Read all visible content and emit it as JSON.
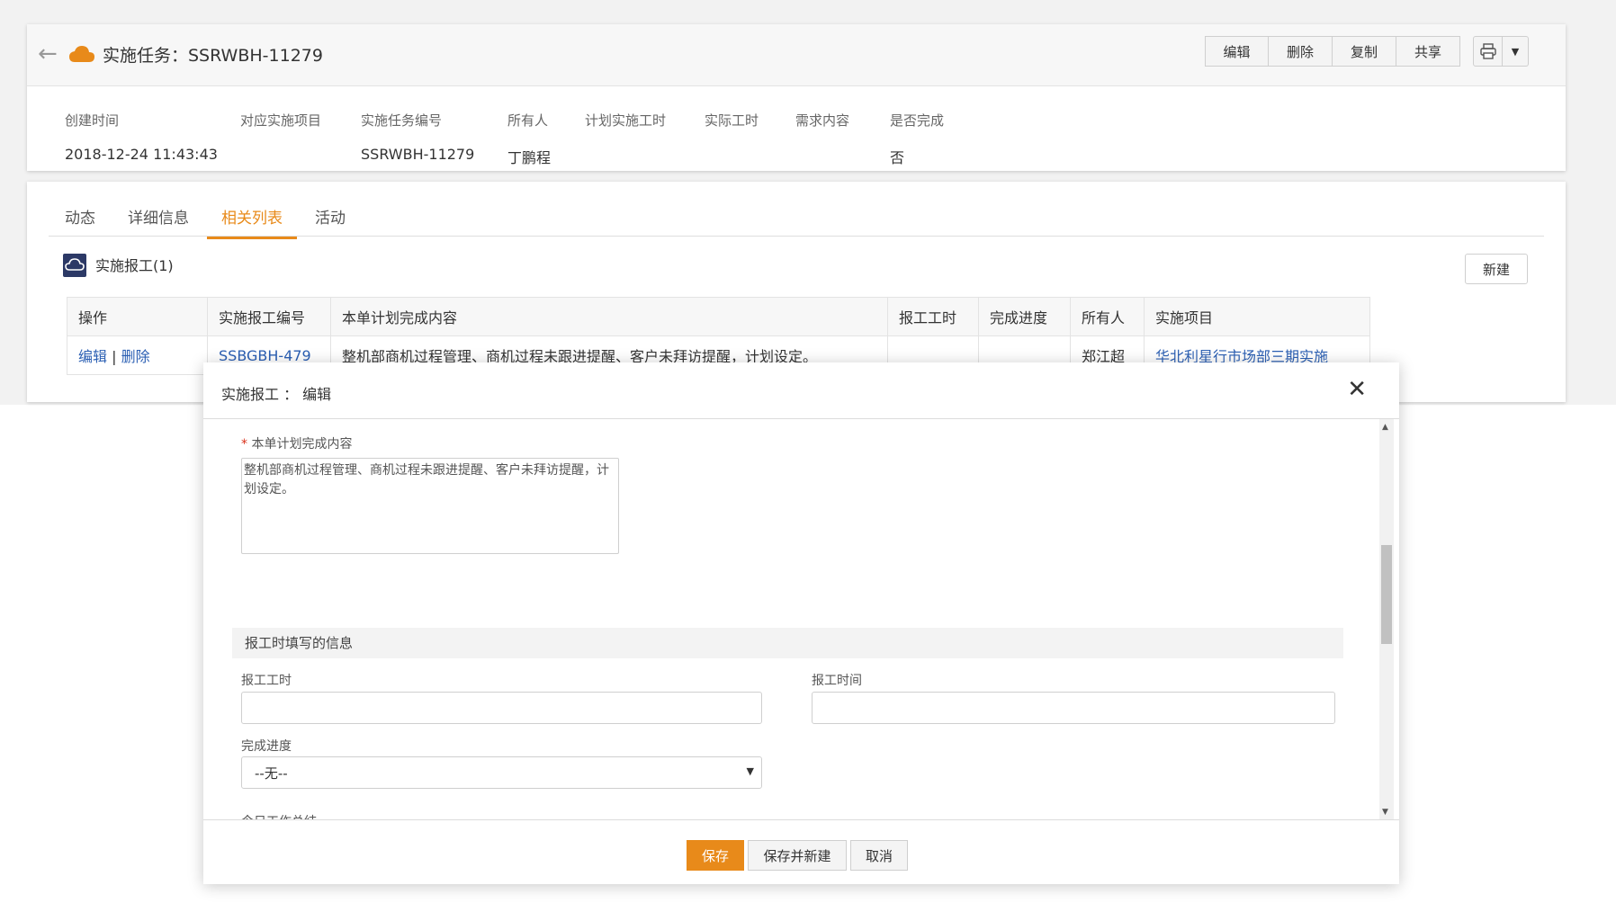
{
  "header": {
    "title": "实施任务：SSRWBH-11279",
    "buttons": [
      "编辑",
      "删除",
      "复制",
      "共享"
    ],
    "fields": [
      {
        "label": "创建时间",
        "value": "2018-12-24 11:43:43"
      },
      {
        "label": "对应实施项目",
        "value": ""
      },
      {
        "label": "实施任务编号",
        "value": "SSRWBH-11279"
      },
      {
        "label": "所有人",
        "value": "丁鹏程"
      },
      {
        "label": "计划实施工时",
        "value": ""
      },
      {
        "label": "实际工时",
        "value": ""
      },
      {
        "label": "需求内容",
        "value": ""
      },
      {
        "label": "是否完成",
        "value": "否"
      }
    ]
  },
  "tabs": [
    "动态",
    "详细信息",
    "相关列表",
    "活动"
  ],
  "related": {
    "section_title": "实施报工(1)",
    "new_button": "新建",
    "columns": [
      "操作",
      "实施报工编号",
      "本单计划完成内容",
      "报工工时",
      "完成进度",
      "所有人",
      "实施项目"
    ],
    "row": {
      "edit": "编辑",
      "sep": "|",
      "delete": "删除",
      "number": "SSBGBH-479",
      "content": "整机部商机过程管理、商机过程未跟进提醒、客户未拜访提醒，计划设定。",
      "hours": "",
      "progress": "",
      "owner": "郑江超",
      "project": "华北利星行市场部三期实施"
    }
  },
  "modal": {
    "title": "实施报工 ： 编辑",
    "content_label": "本单计划完成内容",
    "content_value": "整机部商机过程管理、商机过程未跟进提醒、客户未拜访提醒，计划设定。",
    "group_title": "报工时填写的信息",
    "hours_label": "报工工时",
    "time_label": "报工时间",
    "progress_label": "完成进度",
    "progress_value": "--无--",
    "summary_label": "今日工作总结",
    "save": "保存",
    "save_new": "保存并新建",
    "cancel": "取消"
  },
  "colors": {
    "accent": "#e88a1a",
    "link": "#2b5fb3",
    "section_icon": "#2c3966"
  }
}
